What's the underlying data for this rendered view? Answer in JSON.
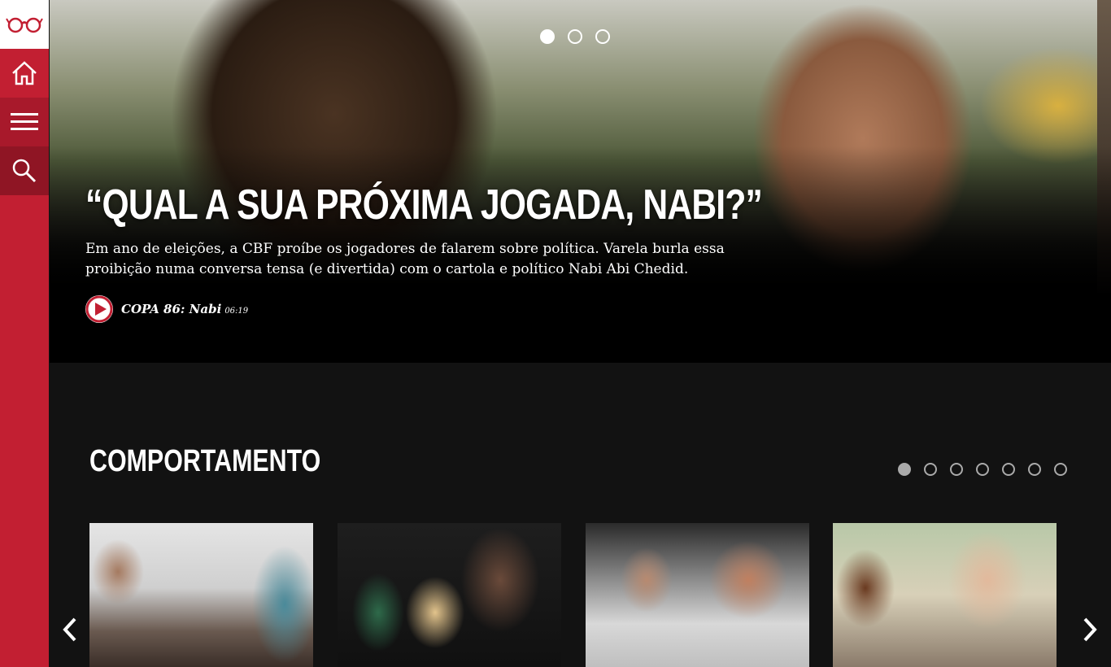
{
  "sidebar": {
    "logo_icon": "glasses-icon",
    "items": [
      {
        "name": "home",
        "icon": "home-icon"
      },
      {
        "name": "menu",
        "icon": "menu-icon"
      },
      {
        "name": "search",
        "icon": "search-icon"
      }
    ],
    "colors": {
      "accent": "#c21f32",
      "logo_bg": "#ffffff"
    }
  },
  "hero": {
    "carousel": {
      "total": 3,
      "active": 1
    },
    "title": "“QUAL A SUA PRÓXIMA JOGADA, NABI?”",
    "description": "Em ano de eleições, a CBF proíbe os jogadores de falarem sobre política. Varela burla essa proibição numa conversa tensa (e divertida) com o cartola e político Nabi Abi Chedid.",
    "video": {
      "icon": "play-icon",
      "title": "COPA 86: Nabi",
      "duration": "06:19"
    }
  },
  "section": {
    "title": "COMPORTAMENTO",
    "carousel": {
      "total": 7,
      "active": 1
    },
    "nav": {
      "prev_icon": "chevron-left-icon",
      "next_icon": "chevron-right-icon"
    },
    "thumbnails": 4
  },
  "colors": {
    "background": "#121212",
    "hero_bg": "#000000",
    "text": "#ffffff"
  }
}
